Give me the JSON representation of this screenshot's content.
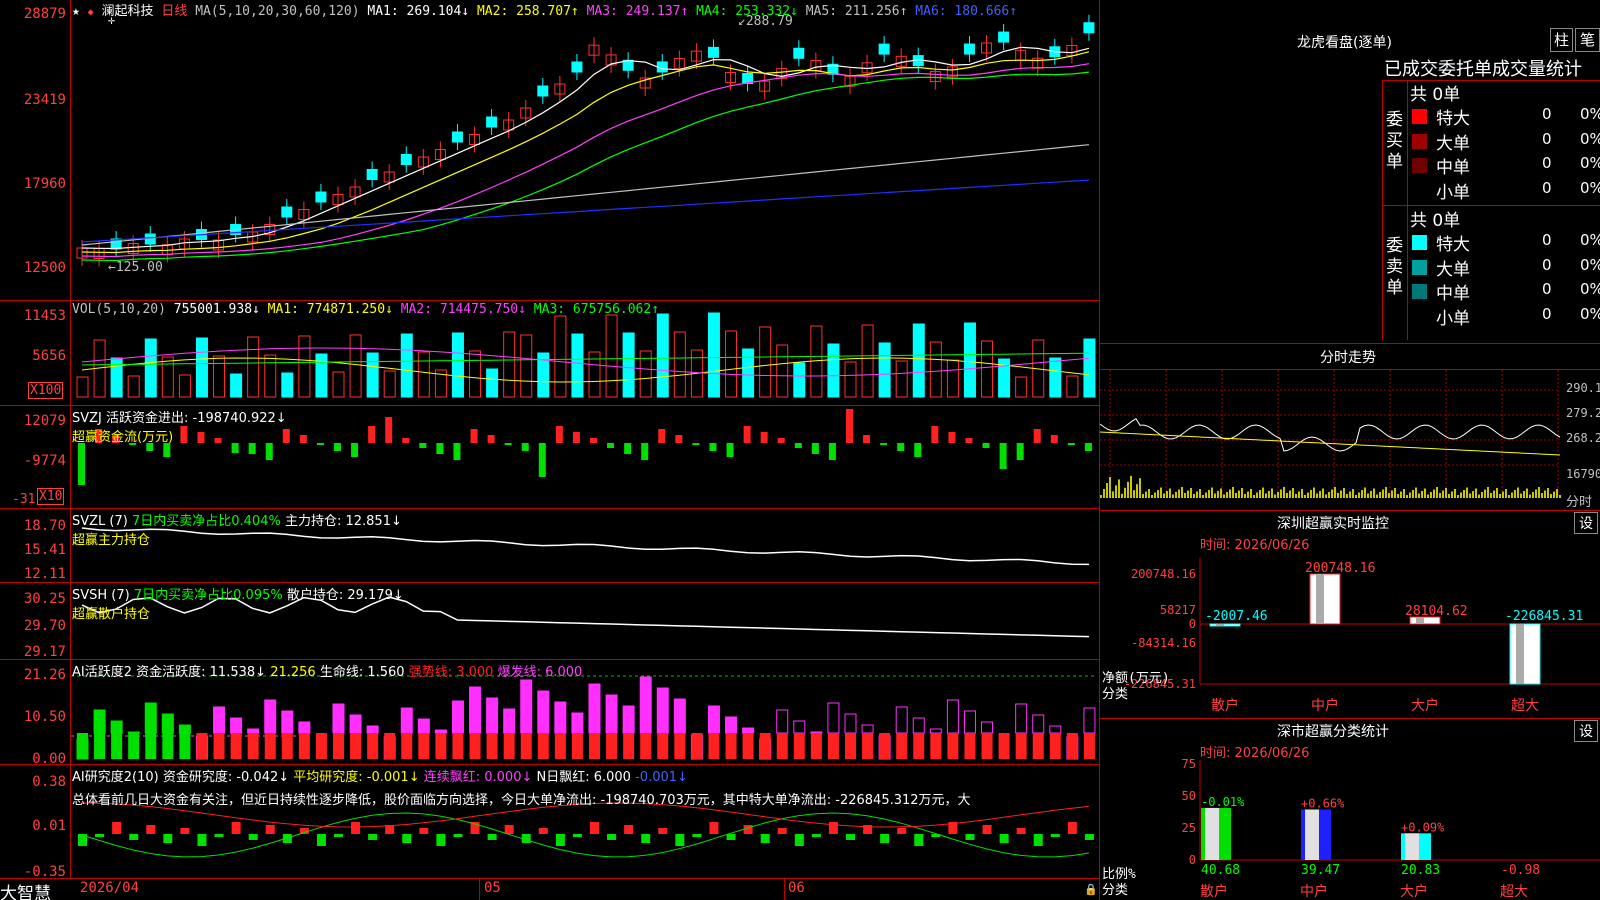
{
  "stock": {
    "name": "澜起科技",
    "period": "日线",
    "star": "★",
    "diamond": "◆"
  },
  "main_pane": {
    "ma_header": "MA(5,10,20,30,60,120)",
    "ma1": "MA1: 269.104↓",
    "ma2": "MA2: 258.707↑",
    "ma3": "MA3: 249.137↑",
    "ma4": "MA4: 253.332↓",
    "ma5": "MA5: 211.256↑",
    "ma6": "MA6: 180.666↑",
    "high_label": "288.79",
    "low_label": "125.00",
    "y_ticks": [
      "28879",
      "23419",
      "17960",
      "12500"
    ]
  },
  "vol_pane": {
    "header": "VOL(5,10,20)",
    "value": "755001.938↓",
    "ma1": "MA1: 774871.250↓",
    "ma2": "MA2: 714475.750↓",
    "ma3": "MA3: 675756.062↑",
    "y_ticks": [
      "11453",
      "5656"
    ],
    "multiplier": "X100"
  },
  "svzj_pane": {
    "header": "SVZJ  活跃资金进出: -198740.922↓",
    "subtitle": "超赢资金流(万元)",
    "y_ticks": [
      "12079",
      "-9774",
      "-31"
    ],
    "multiplier": "X10"
  },
  "svzl_pane": {
    "header": "SVZL (7)",
    "hl": "7日内买卖净占比0.404%",
    "tail": "主力持仓: 12.851↓",
    "subtitle": "超赢主力持仓",
    "y_ticks": [
      "18.70",
      "15.41",
      "12.11"
    ]
  },
  "svsh_pane": {
    "header": "SVSH (7)",
    "hl": "7日内买卖净占比0.095%",
    "tail": "散户持仓: 29.179↓",
    "subtitle": "超赢散户持仓",
    "y_ticks": [
      "30.25",
      "29.70",
      "29.17"
    ]
  },
  "ai_active": {
    "header": "AI活跃度2",
    "a": "资金活跃度: 11.538↓",
    "b": "21.256",
    "c": "生命线: 1.560",
    "d": "强势线: 3.000",
    "e": "爆发线: 6.000",
    "y_ticks": [
      "21.26",
      "10.50",
      "0.00"
    ]
  },
  "ai_research": {
    "header": "AI研究度2(10)",
    "a": "资金研究度: -0.042↓",
    "b": "平均研究度: -0.001↓",
    "c": "连续飘红: 0.000↓",
    "d": "N日飘红: 6.000",
    "e": "-0.001↓",
    "comment": "总体看前几日大资金有关注，但近日持续性逐步降低，股价面临方向选择，今日大单净流出: -198740.703万元，其中特大单净流出: -226845.312万元，大",
    "y_ticks": [
      "0.38",
      "0.01",
      "-0.35"
    ]
  },
  "x_axis": {
    "d1": "2026/04",
    "d2": "05",
    "d3": "06"
  },
  "bottom": {
    "brand": "大智慧"
  },
  "lhb": {
    "title": "龙虎看盘(逐单)",
    "btn1": "柱",
    "btn2": "笔",
    "header": "已成交委托单成交量统计",
    "buy_label": "委买单",
    "sell_label": "委卖单",
    "buy_total": "共 0单",
    "sell_total": "共 0单",
    "buy_rows": [
      {
        "label": "特大",
        "v": "0",
        "p": "0%",
        "color": "#ff0000"
      },
      {
        "label": "大单",
        "v": "0",
        "p": "0%",
        "color": "#a00000"
      },
      {
        "label": "中单",
        "v": "0",
        "p": "0%",
        "color": "#700000"
      },
      {
        "label": "小单",
        "v": "0",
        "p": "0%",
        "color": "#000000"
      }
    ],
    "sell_rows": [
      {
        "label": "特大",
        "v": "0",
        "p": "0%",
        "color": "#00ffff"
      },
      {
        "label": "大单",
        "v": "0",
        "p": "0%",
        "color": "#00a0a0"
      },
      {
        "label": "中单",
        "v": "0",
        "p": "0%",
        "color": "#007878"
      },
      {
        "label": "小单",
        "v": "0",
        "p": "0%",
        "color": "#000000"
      }
    ]
  },
  "intraday": {
    "title": "分时走势",
    "y_ticks": [
      "290.1",
      "279.2",
      "268.2",
      "16790"
    ],
    "xlabel": "分时"
  },
  "sz_monitor": {
    "title": "深圳超赢实时监控",
    "set": "设",
    "time": "时间: 2026/06/26",
    "y_ticks": [
      "200748.16",
      "58217",
      "0",
      "-84314.16",
      "-226845.31"
    ],
    "ylabel": "净额(万元)",
    "xlabel": "分类",
    "bars": [
      {
        "cat": "散户",
        "value": "-2007.46"
      },
      {
        "cat": "中户",
        "value": "200748.16"
      },
      {
        "cat": "大户",
        "value": "28104.62"
      },
      {
        "cat": "超大",
        "value": "-226845.31"
      }
    ]
  },
  "sz_class": {
    "title": "深市超赢分类统计",
    "set": "设",
    "time": "时间: 2026/06/26",
    "y_ticks": [
      "75",
      "50",
      "25",
      "0"
    ],
    "ylabel": "比例%",
    "xlabel": "分类",
    "bars": [
      {
        "cat": "散户",
        "pct": "40.68",
        "chg": "-0.01%"
      },
      {
        "cat": "中户",
        "pct": "39.47",
        "chg": "+0.66%"
      },
      {
        "cat": "大户",
        "pct": "20.83",
        "chg": "+0.09%"
      },
      {
        "cat": "超大",
        "pct": "-0.98",
        "chg": ""
      }
    ]
  }
}
